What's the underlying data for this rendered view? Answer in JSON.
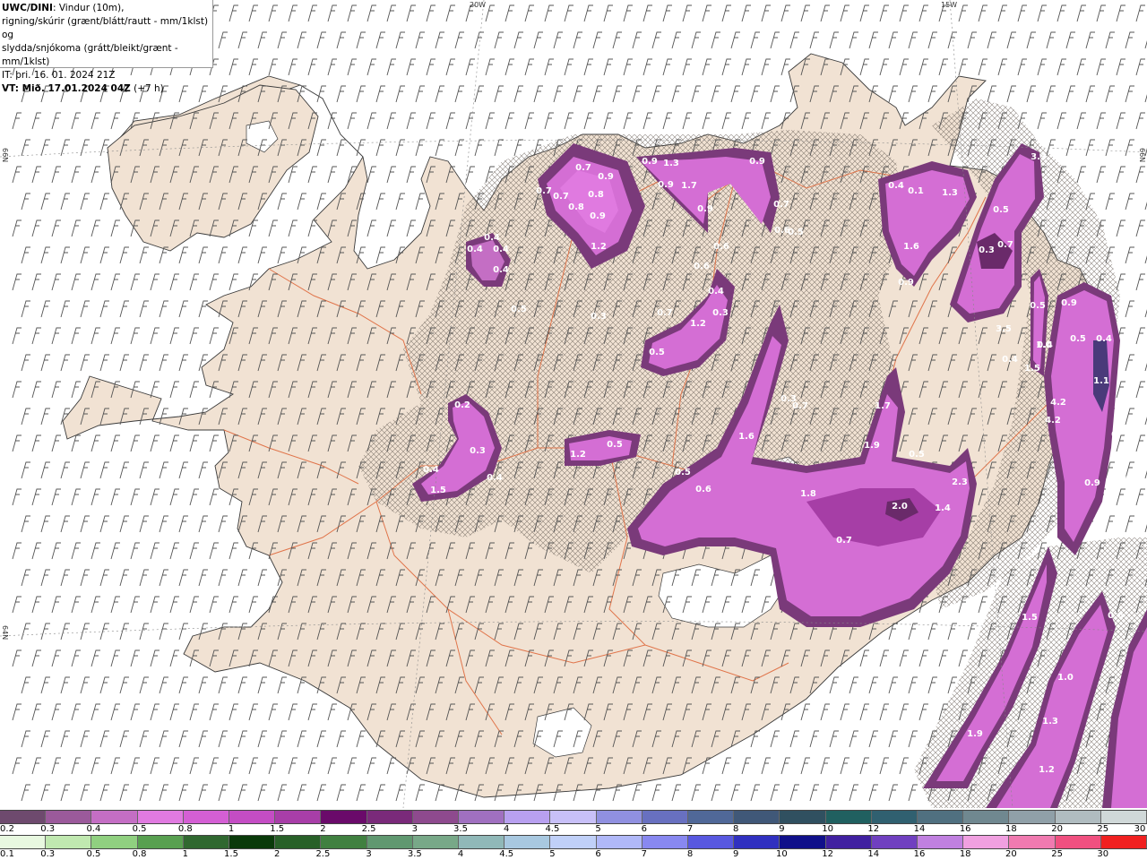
{
  "header": {
    "model": "UWC/DINI",
    "line1": ": Vindur (10m),",
    "line2": "rigning/skúrir (grænt/blátt/rautt - mm/1klst) og",
    "line3": "slydda/snjókoma (grátt/bleikt/grænt - mm/1klst)",
    "it": "IT: þri. 16. 01. 2024 21Z",
    "vt_label": "VT: Mið. 17.01.2024 04Z",
    "vt_extra": " (+7 h)"
  },
  "graticule": {
    "lon1": "20W",
    "lon2": "15W",
    "lat_left1": "66N",
    "lat_left2": "64N",
    "lat_right": "66N"
  },
  "values": [
    "0.7",
    "0.9",
    "0.8",
    "0.7",
    "0.8",
    "0.7",
    "0.9",
    "1.2",
    "0.9",
    "1.3",
    "0.9",
    "1.7",
    "0.9",
    "0.9",
    "0.7",
    "0.6",
    "0.5",
    "0.4",
    "0.4",
    "0.4",
    "0.4",
    "0.5",
    "0.3",
    "0.6",
    "0.6",
    "0.4",
    "0.3",
    "0.7",
    "1.2",
    "0.5",
    "0.3",
    "0.7",
    "0.2",
    "0.3",
    "0.4",
    "1.5",
    "0.4",
    "1.2",
    "0.5",
    "0.5",
    "0.6",
    "1.6",
    "1.8",
    "0.7",
    "2.0",
    "1.4",
    "2.3",
    "1.7",
    "1.9",
    "0.5",
    "0.4",
    "0.1",
    "1.3",
    "1.6",
    "0.9",
    "0.5",
    "0.3",
    "0.7",
    "3.3",
    "3.5",
    "0.4",
    "0.5",
    "0.9",
    "0.4",
    "1.5",
    "0.5",
    "0.4",
    "1.1",
    "4.2",
    "4.2",
    "0.9",
    "0.9",
    "0.6",
    "1.5",
    "1.0",
    "1.3",
    "1.2",
    "1.9",
    "0.6",
    "1.0",
    "0.4"
  ],
  "legend_snow": {
    "labels": [
      "0.2",
      "0.3",
      "0.4",
      "0.5",
      "0.8",
      "1",
      "1.5",
      "2",
      "2.5",
      "3",
      "3.5",
      "4",
      "4.5",
      "5",
      "6",
      "7",
      "8",
      "9",
      "10",
      "12",
      "14",
      "16",
      "18",
      "20",
      "25",
      "30"
    ],
    "colors": [
      "#6e4a6e",
      "#9b5a9b",
      "#c46ec4",
      "#e07ae0",
      "#d45fd4",
      "#c44dc4",
      "#a83ea8",
      "#6a0a6a",
      "#7a2a7a",
      "#8e4a8e",
      "#a070c0",
      "#b8a0f0",
      "#c8c0f8",
      "#9090e0",
      "#6870c0",
      "#506898",
      "#405878",
      "#305060",
      "#206060",
      "#306070",
      "#507080",
      "#708890",
      "#90a0a8",
      "#b0bcc0",
      "#d0d8d8"
    ]
  },
  "legend_rain": {
    "labels": [
      "0.1",
      "0.3",
      "0.5",
      "0.8",
      "1",
      "1.5",
      "2",
      "2.5",
      "3",
      "3.5",
      "4",
      "4.5",
      "5",
      "6",
      "7",
      "8",
      "9",
      "10",
      "12",
      "14",
      "16",
      "18",
      "20",
      "25",
      "30"
    ],
    "colors": [
      "#e8f8e0",
      "#c0e8b0",
      "#90d080",
      "#58a050",
      "#306830",
      "#0a3a0a",
      "#286028",
      "#408040",
      "#609870",
      "#78a888",
      "#90b8b8",
      "#a8c8e0",
      "#c0d0f8",
      "#b0b8f8",
      "#8888f0",
      "#5858e0",
      "#3030c0",
      "#10108a",
      "#4020a0",
      "#7040c0",
      "#c080e0",
      "#f0a0e0",
      "#f07ab0",
      "#f05080",
      "#f02020"
    ]
  }
}
